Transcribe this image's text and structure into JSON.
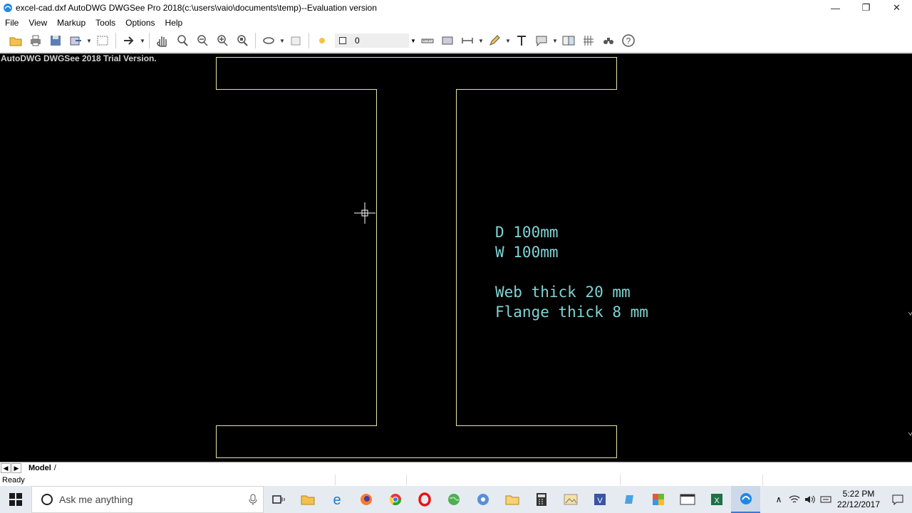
{
  "window": {
    "title": "excel-cad.dxf AutoDWG DWGSee Pro 2018(c:\\users\\vaio\\documents\\temp)--Evaluation version",
    "minimize_label": "—",
    "restore_label": "❐",
    "close_label": "✕"
  },
  "menu": {
    "items": [
      "File",
      "View",
      "Markup",
      "Tools",
      "Options",
      "Help"
    ]
  },
  "toolbar": {
    "layer_value": "0"
  },
  "canvas": {
    "trial_label": "AutoDWG DWGSee 2018 Trial Version.",
    "annotations": {
      "line1": "D    100mm",
      "line2": "W    100mm",
      "line3": "Web  thick   20 mm",
      "line4": "Flange  thick   8  mm"
    },
    "colors": {
      "background": "#000000",
      "outline": "#e6e6a0",
      "text": "#7fd4d4"
    }
  },
  "tabs": {
    "active": "Model"
  },
  "status": {
    "text": "Ready"
  },
  "taskbar": {
    "search_placeholder": "Ask me anything",
    "time": "5:22 PM",
    "date": "22/12/2017"
  }
}
